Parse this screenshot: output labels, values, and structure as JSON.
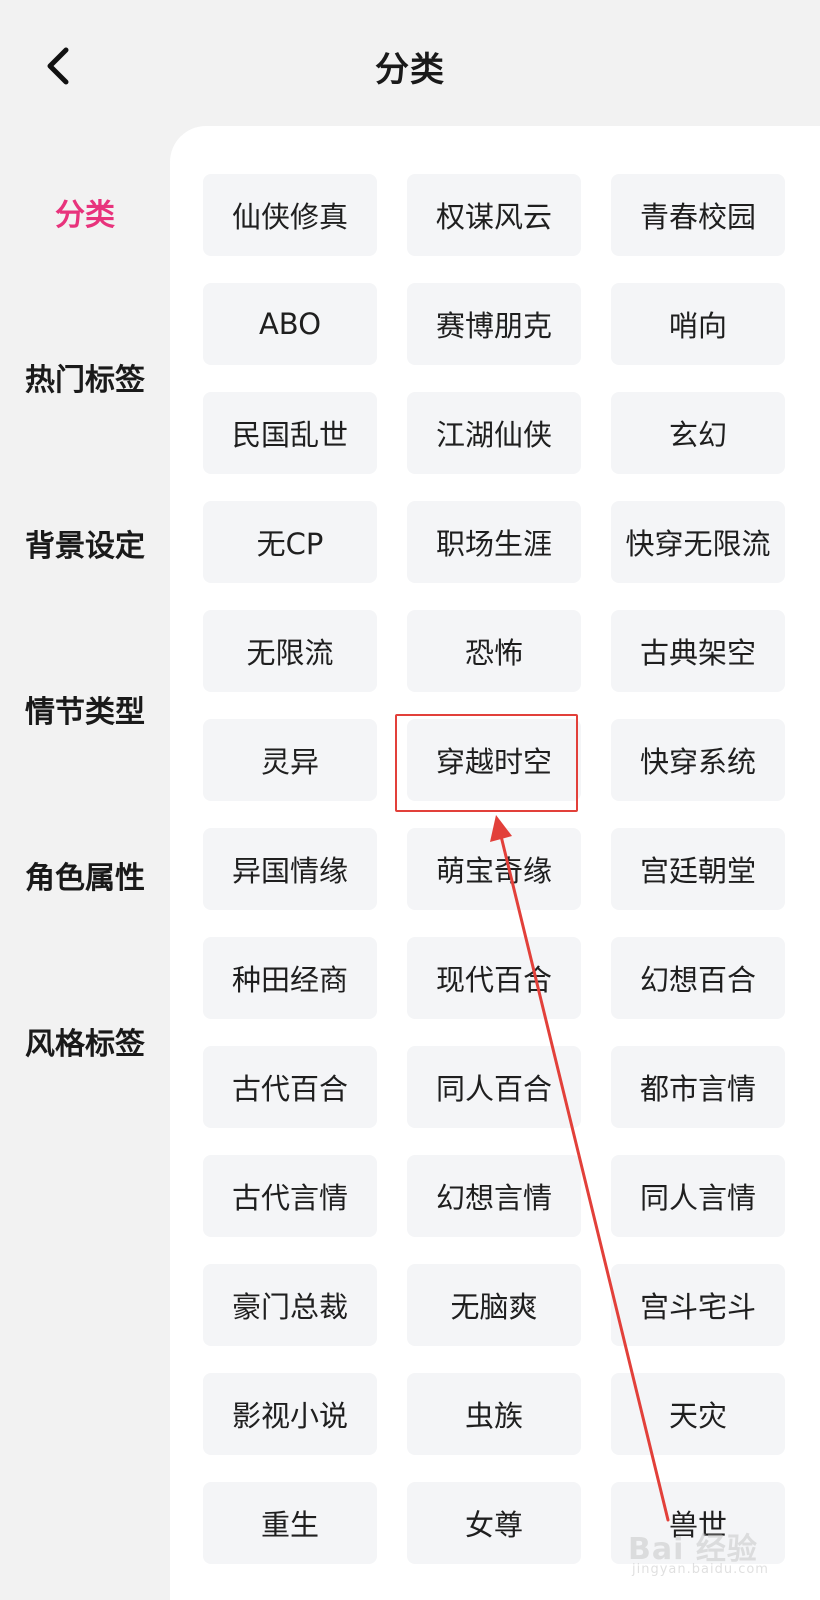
{
  "header": {
    "title": "分类",
    "back_icon": "chevron-left-icon"
  },
  "sidebar": {
    "active_color": "#e8337c",
    "items": [
      {
        "label": "分类",
        "active": true
      },
      {
        "label": "热门标签",
        "active": false
      },
      {
        "label": "背景设定",
        "active": false
      },
      {
        "label": "情节类型",
        "active": false
      },
      {
        "label": "角色属性",
        "active": false
      },
      {
        "label": "风格标签",
        "active": false
      }
    ]
  },
  "tags": [
    [
      "仙侠修真",
      "权谋风云",
      "青春校园"
    ],
    [
      "ABO",
      "赛博朋克",
      "哨向"
    ],
    [
      "民国乱世",
      "江湖仙侠",
      "玄幻"
    ],
    [
      "无CP",
      "职场生涯",
      "快穿无限流"
    ],
    [
      "无限流",
      "恐怖",
      "古典架空"
    ],
    [
      "灵异",
      "穿越时空",
      "快穿系统"
    ],
    [
      "异国情缘",
      "萌宝奇缘",
      "宫廷朝堂"
    ],
    [
      "种田经商",
      "现代百合",
      "幻想百合"
    ],
    [
      "古代百合",
      "同人百合",
      "都市言情"
    ],
    [
      "古代言情",
      "幻想言情",
      "同人言情"
    ],
    [
      "豪门总裁",
      "无脑爽",
      "宫斗宅斗"
    ],
    [
      "影视小说",
      "虫族",
      "天灾"
    ],
    [
      "重生",
      "女尊",
      "兽世"
    ]
  ],
  "annotation": {
    "highlighted_tag": "穿越时空",
    "color": "#e2403a"
  },
  "watermark": {
    "main": "Bai 经验",
    "sub": "jingyan.baidu.com"
  }
}
